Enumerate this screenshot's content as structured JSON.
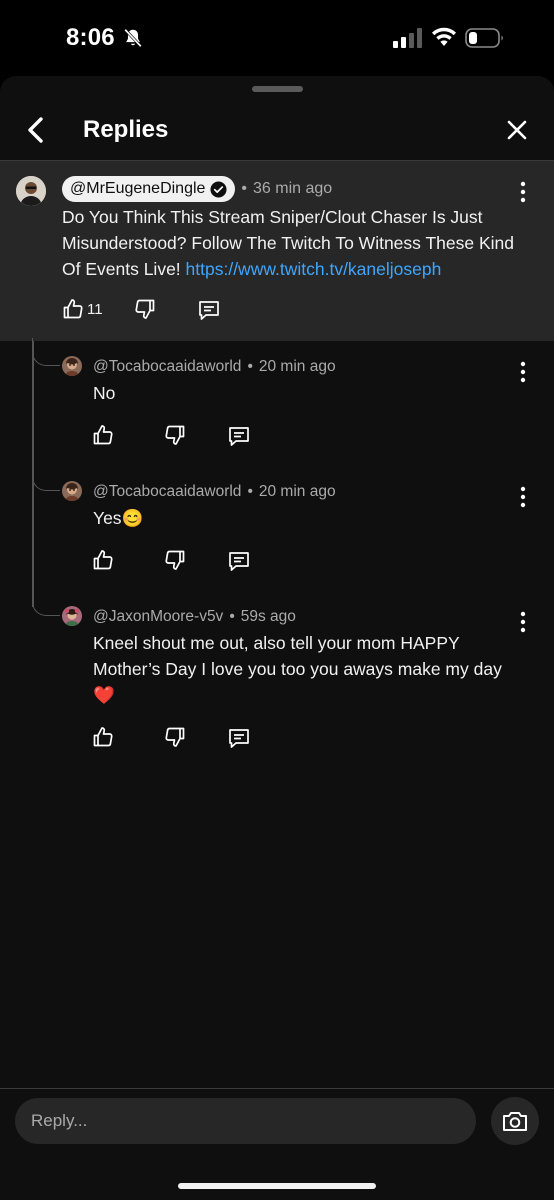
{
  "status_bar": {
    "time": "8:06"
  },
  "header": {
    "title": "Replies"
  },
  "main_comment": {
    "author": "@MrEugeneDingle",
    "time": "36 min ago",
    "text": "Do You Think This Stream Sniper/Clout Chaser Is Just Misunderstood? Follow The Twitch To Witness These Kind Of Events Live! ",
    "link": "https://www.twitch.tv/kaneljoseph",
    "likes": "11"
  },
  "replies": [
    {
      "author": "@Tocabocaaidaworld",
      "time": "20 min ago",
      "text": "No"
    },
    {
      "author": "@Tocabocaaidaworld",
      "time": "20 min ago",
      "text": "Yes😊"
    },
    {
      "author": "@JaxonMoore-v5v",
      "time": "59s ago",
      "text": "Kneel shout me out, also tell your mom HAPPY Mother’s Day I love you too you aways make my day❤️"
    }
  ],
  "separator": "•",
  "reply_box": {
    "placeholder": "Reply..."
  }
}
